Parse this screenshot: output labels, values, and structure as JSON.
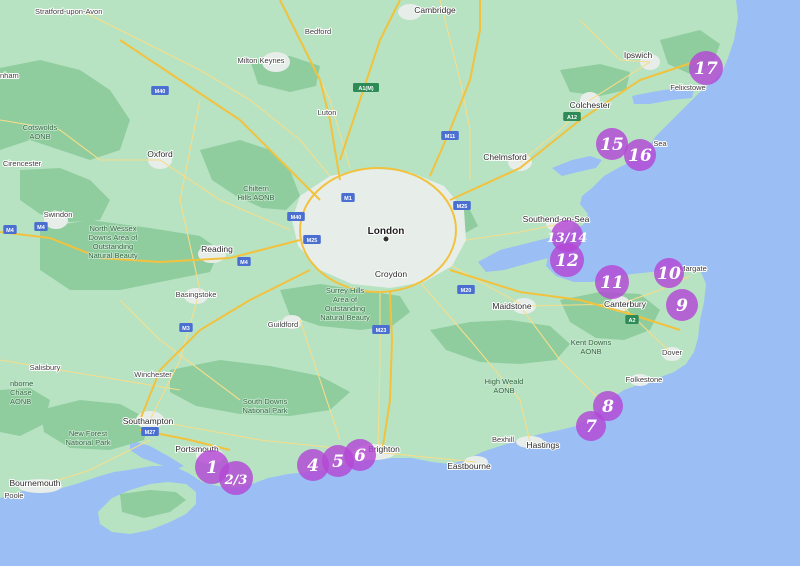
{
  "map": {
    "colors": {
      "sea": "#9bbff4",
      "land": "#b7e3c3",
      "forest": "#8fcd9e",
      "urban": "#e7ede9",
      "motorway": "#f2c23e",
      "road": "#f6dd8a",
      "marker": "#b347d6"
    },
    "places": [
      {
        "id": "stratford",
        "name": "Stratford-upon-Avon"
      },
      {
        "id": "cambridge",
        "name": "Cambridge"
      },
      {
        "id": "bedford",
        "name": "Bedford"
      },
      {
        "id": "ipswich",
        "name": "Ipswich"
      },
      {
        "id": "felixstowe",
        "name": "Felixstowe"
      },
      {
        "id": "milton-keynes",
        "name": "Milton Keynes"
      },
      {
        "id": "luton",
        "name": "Luton"
      },
      {
        "id": "colchester",
        "name": "Colchester"
      },
      {
        "id": "oxford",
        "name": "Oxford"
      },
      {
        "id": "chelmsford",
        "name": "Chelmsford"
      },
      {
        "id": "cirencester",
        "name": "Cirencester"
      },
      {
        "id": "swindon",
        "name": "Swindon"
      },
      {
        "id": "southend",
        "name": "Southend-on-Sea"
      },
      {
        "id": "london",
        "name": "London"
      },
      {
        "id": "reading",
        "name": "Reading"
      },
      {
        "id": "croydon",
        "name": "Croydon"
      },
      {
        "id": "margate",
        "name": "Margate"
      },
      {
        "id": "basingstoke",
        "name": "Basingstoke"
      },
      {
        "id": "maidstone",
        "name": "Maidstone"
      },
      {
        "id": "canterbury",
        "name": "Canterbury"
      },
      {
        "id": "guildford",
        "name": "Guildford"
      },
      {
        "id": "dover",
        "name": "Dover"
      },
      {
        "id": "salisbury",
        "name": "Salisbury"
      },
      {
        "id": "winchester",
        "name": "Winchester"
      },
      {
        "id": "folkestone",
        "name": "Folkestone"
      },
      {
        "id": "southampton",
        "name": "Southampton"
      },
      {
        "id": "portsmouth",
        "name": "Portsmouth"
      },
      {
        "id": "brighton",
        "name": "Brighton"
      },
      {
        "id": "bexhill",
        "name": "Bexhill"
      },
      {
        "id": "hastings",
        "name": "Hastings"
      },
      {
        "id": "eastbourne",
        "name": "Eastbourne"
      },
      {
        "id": "bournemouth",
        "name": "Bournemouth"
      },
      {
        "id": "poole",
        "name": "Poole"
      },
      {
        "id": "nham",
        "name": "nham"
      },
      {
        "id": "sea",
        "name": "Sea"
      }
    ],
    "parks": [
      {
        "id": "cotswolds",
        "lines": [
          "Cotswolds",
          "AONB"
        ]
      },
      {
        "id": "chiltern",
        "lines": [
          "Chiltern",
          "Hills AONB"
        ]
      },
      {
        "id": "north-wessex",
        "lines": [
          "North Wessex",
          "Downs Area of",
          "Outstanding",
          "Natural Beauty"
        ]
      },
      {
        "id": "surrey-hills",
        "lines": [
          "Surrey Hills",
          "Area of",
          "Outstanding",
          "Natural Beauty"
        ]
      },
      {
        "id": "kent-downs",
        "lines": [
          "Kent Downs",
          "AONB"
        ]
      },
      {
        "id": "high-weald",
        "lines": [
          "High Weald",
          "AONB"
        ]
      },
      {
        "id": "south-downs",
        "lines": [
          "South Downs",
          "National Park"
        ]
      },
      {
        "id": "new-forest",
        "lines": [
          "New Forest",
          "National Park"
        ]
      },
      {
        "id": "cranborne",
        "lines": [
          "nborne",
          "Chase",
          "AONB"
        ]
      }
    ],
    "road_shields": [
      {
        "id": "m40-north",
        "label": "M40"
      },
      {
        "id": "a1m",
        "label": "A1(M)"
      },
      {
        "id": "m11",
        "label": "M11"
      },
      {
        "id": "a12",
        "label": "A12"
      },
      {
        "id": "m1",
        "label": "M1"
      },
      {
        "id": "m25-east",
        "label": "M25"
      },
      {
        "id": "m40-south",
        "label": "M40"
      },
      {
        "id": "m25-west",
        "label": "M25"
      },
      {
        "id": "m4-west",
        "label": "M4"
      },
      {
        "id": "m4-east",
        "label": "M4"
      },
      {
        "id": "m4-far-west",
        "label": "M4"
      },
      {
        "id": "m20",
        "label": "M20"
      },
      {
        "id": "m23",
        "label": "M23"
      },
      {
        "id": "m3",
        "label": "M3"
      },
      {
        "id": "a2",
        "label": "A2"
      },
      {
        "id": "m27",
        "label": "M27"
      }
    ],
    "markers": [
      {
        "id": "1",
        "label": "1"
      },
      {
        "id": "2-3",
        "label": "2/3"
      },
      {
        "id": "4",
        "label": "4"
      },
      {
        "id": "5",
        "label": "5"
      },
      {
        "id": "6",
        "label": "6"
      },
      {
        "id": "7",
        "label": "7"
      },
      {
        "id": "8",
        "label": "8"
      },
      {
        "id": "9",
        "label": "9"
      },
      {
        "id": "10",
        "label": "10"
      },
      {
        "id": "11",
        "label": "11"
      },
      {
        "id": "12",
        "label": "12"
      },
      {
        "id": "13-14",
        "label": "13/14"
      },
      {
        "id": "15",
        "label": "15"
      },
      {
        "id": "16",
        "label": "16"
      },
      {
        "id": "17",
        "label": "17"
      }
    ]
  }
}
